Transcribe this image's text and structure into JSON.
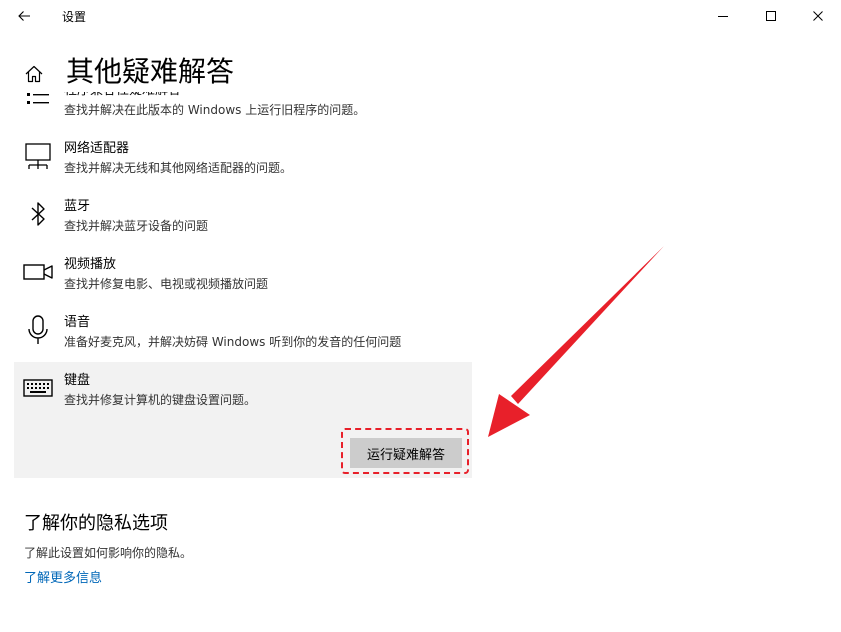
{
  "window": {
    "title": "设置"
  },
  "page": {
    "title": "其他疑难解答"
  },
  "troubleshooters": [
    {
      "name": "程序兼容性疑难解答",
      "description": "查找并解决在此版本的 Windows 上运行旧程序的问题。",
      "icon": "list-icon"
    },
    {
      "name": "网络适配器",
      "description": "查找并解决无线和其他网络适配器的问题。",
      "icon": "network-adapter-icon"
    },
    {
      "name": "蓝牙",
      "description": "查找并解决蓝牙设备的问题",
      "icon": "bluetooth-icon"
    },
    {
      "name": "视频播放",
      "description": "查找并修复电影、电视或视频播放问题",
      "icon": "video-camera-icon"
    },
    {
      "name": "语音",
      "description": "准备好麦克风，并解决妨碍 Windows 听到你的发音的任何问题",
      "icon": "microphone-icon"
    },
    {
      "name": "键盘",
      "description": "查找并修复计算机的键盘设置问题。",
      "icon": "keyboard-icon"
    }
  ],
  "run_button_label": "运行疑难解答",
  "privacy": {
    "title": "了解你的隐私选项",
    "description": "了解此设置如何影响你的隐私。",
    "link": "了解更多信息"
  },
  "colors": {
    "accent_link": "#0067b8",
    "annotation_red": "#e8202a",
    "selected_bg": "#f2f2f2"
  }
}
